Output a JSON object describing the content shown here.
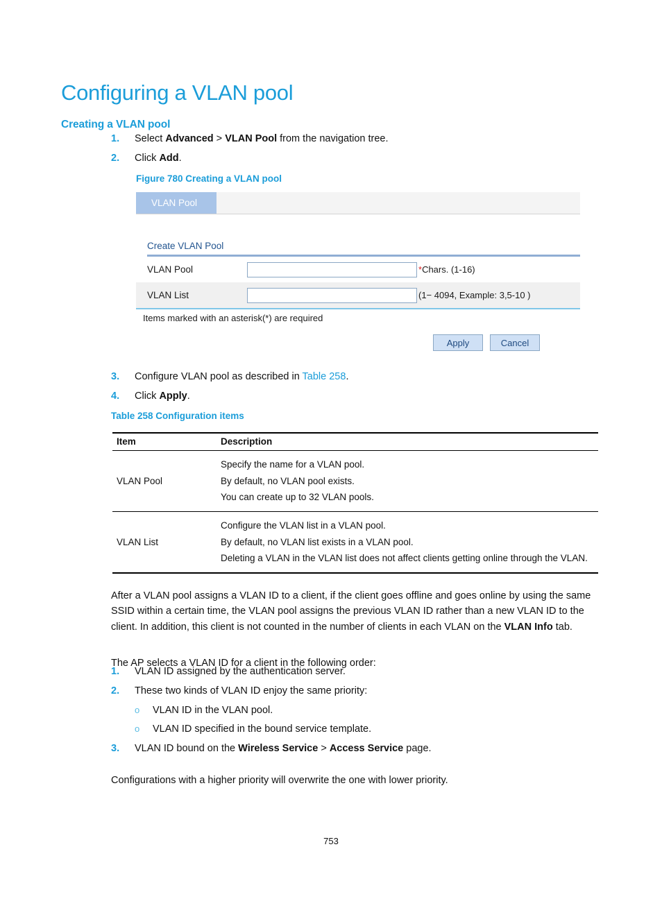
{
  "document": {
    "title": "Configuring a VLAN pool",
    "section_heading": "Creating a VLAN pool",
    "page_number": "753"
  },
  "steps_create": [
    {
      "num": "1.",
      "prefix": "Select ",
      "bold1": "Advanced",
      "mid": " > ",
      "bold2": "VLAN Pool",
      "suffix": " from the navigation tree."
    },
    {
      "num": "2.",
      "prefix": "Click ",
      "bold1": "Add",
      "suffix": "."
    }
  ],
  "figure": {
    "caption": "Figure 780 Creating a VLAN pool",
    "tab_label": "VLAN Pool",
    "panel_title": "Create VLAN Pool",
    "fields": [
      {
        "label": "VLAN Pool",
        "value": "",
        "placeholder": "",
        "required_mark": "*",
        "hint": "Chars. (1-16)"
      },
      {
        "label": "VLAN List",
        "value": "",
        "placeholder": "",
        "required_mark": "",
        "hint": "(1− 4094, Example: 3,5-10 )"
      }
    ],
    "required_note": "Items marked with an asterisk(*) are required",
    "apply_label": "Apply",
    "cancel_label": "Cancel"
  },
  "steps_configure": [
    {
      "num": "3.",
      "prefix": "Configure VLAN pool as described in ",
      "xref": "Table 258",
      "suffix": "."
    },
    {
      "num": "4.",
      "prefix": "Click ",
      "bold1": "Apply",
      "suffix": "."
    }
  ],
  "table": {
    "caption": "Table 258 Configuration items",
    "headers": {
      "item": "Item",
      "description": "Description"
    },
    "rows": [
      {
        "item": "VLAN Pool",
        "description": [
          "Specify the name for a VLAN pool.",
          "By default, no VLAN pool exists.",
          "You can create up to 32 VLAN pools."
        ]
      },
      {
        "item": "VLAN List",
        "description": [
          "Configure the VLAN list in a VLAN pool.",
          "By default, no VLAN list exists in a VLAN pool.",
          "Deleting a VLAN in the VLAN list does not affect clients getting online through the VLAN."
        ]
      }
    ]
  },
  "paragraphs": {
    "after_pool": {
      "part1": "After a VLAN pool assigns a VLAN ID to a client, if the client goes offline and goes online by using the same SSID within a certain time, the VLAN pool assigns the previous VLAN ID rather than a new VLAN ID to the client. In addition, this client is not counted in the number of clients in each VLAN on the ",
      "bold": "VLAN Info",
      "part2": " tab."
    },
    "order_intro": "The AP selects a VLAN ID for a client in the following order:",
    "final": "Configurations with a higher priority will overwrite the one with lower priority."
  },
  "steps_priority": [
    {
      "num": "1.",
      "text": "VLAN ID assigned by the authentication server."
    },
    {
      "num": "2.",
      "text": "These two kinds of VLAN ID enjoy the same priority:"
    }
  ],
  "sub_bullets": [
    {
      "marker": "o",
      "text": "VLAN ID in the VLAN pool."
    },
    {
      "marker": "o",
      "text": "VLAN ID specified in the bound service template."
    }
  ],
  "step_priority_3": {
    "num": "3.",
    "prefix": "VLAN ID bound on the ",
    "bold1": "Wireless Service",
    "mid": " > ",
    "bold2": "Access Service",
    "suffix": " page."
  },
  "colors": {
    "accent_blue": "#1b9dd9",
    "tab_blue": "#a8c4e8",
    "panel_rule": "#8faed4",
    "button_blue": "#cfe0f5",
    "required_red": "#dd2222"
  }
}
